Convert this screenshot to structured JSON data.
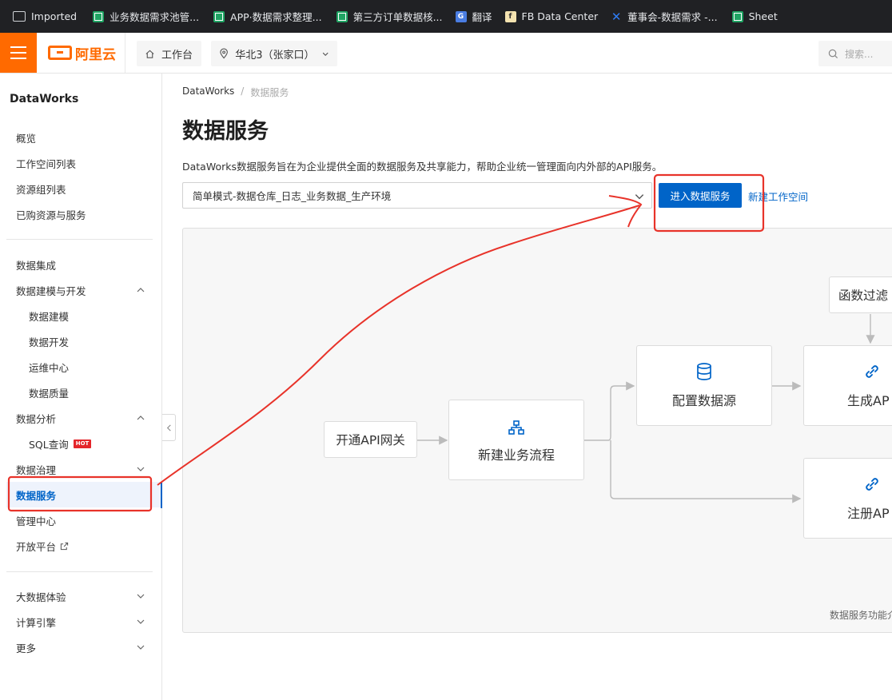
{
  "bookmarks": [
    {
      "label": "Imported",
      "icon": "folder-icon"
    },
    {
      "label": "业务数据需求池管...",
      "icon": "sheet-icon"
    },
    {
      "label": "APP·数据需求整理...",
      "icon": "sheet-icon"
    },
    {
      "label": "第三方订单数据核...",
      "icon": "sheet-icon"
    },
    {
      "label": "翻译",
      "icon": "translate-icon"
    },
    {
      "label": "FB Data Center",
      "icon": "fb-icon"
    },
    {
      "label": "董事会-数据需求 -...",
      "icon": "confluence-icon"
    },
    {
      "label": "Sheet",
      "icon": "sheet-icon"
    }
  ],
  "topnav": {
    "logo_text": "阿里云",
    "workbench_label": "工作台",
    "region_label": "华北3（张家口）",
    "search_placeholder": "搜索..."
  },
  "sidebar": {
    "title": "DataWorks",
    "group1": [
      "概览",
      "工作空间列表",
      "资源组列表",
      "已购资源与服务"
    ],
    "group2": {
      "integration": "数据集成",
      "modeling_dev": "数据建模与开发",
      "modeling": "数据建模",
      "development": "数据开发",
      "ops": "运维中心",
      "quality": "数据质量",
      "analysis": "数据分析",
      "sql": "SQL查询",
      "hot_badge": "HOT",
      "governance": "数据治理",
      "service": "数据服务",
      "admin": "管理中心",
      "open_platform": "开放平台"
    },
    "group3": [
      "大数据体验",
      "计算引擎",
      "更多"
    ]
  },
  "main": {
    "breadcrumb_root": "DataWorks",
    "breadcrumb_sep": "/",
    "breadcrumb_current": "数据服务",
    "title": "数据服务",
    "description": "DataWorks数据服务旨在为企业提供全面的数据服务及共享能力，帮助企业统一管理面向内外部的API服务。",
    "workspace_select": "简单模式-数据仓库_日志_业务数据_生产环境",
    "enter_button": "进入数据服务",
    "new_workspace_link": "新建工作空间"
  },
  "flow": {
    "open_gateway": "开通API网关",
    "new_process": "新建业务流程",
    "config_source": "配置数据源",
    "generate_api": "生成AP",
    "register_api": "注册AP",
    "function_filter": "函数过滤",
    "caption": "数据服务功能介绍"
  },
  "colors": {
    "brand_orange": "#ff6a00",
    "primary_blue": "#0064c8",
    "annotation_red": "#e8332a"
  }
}
